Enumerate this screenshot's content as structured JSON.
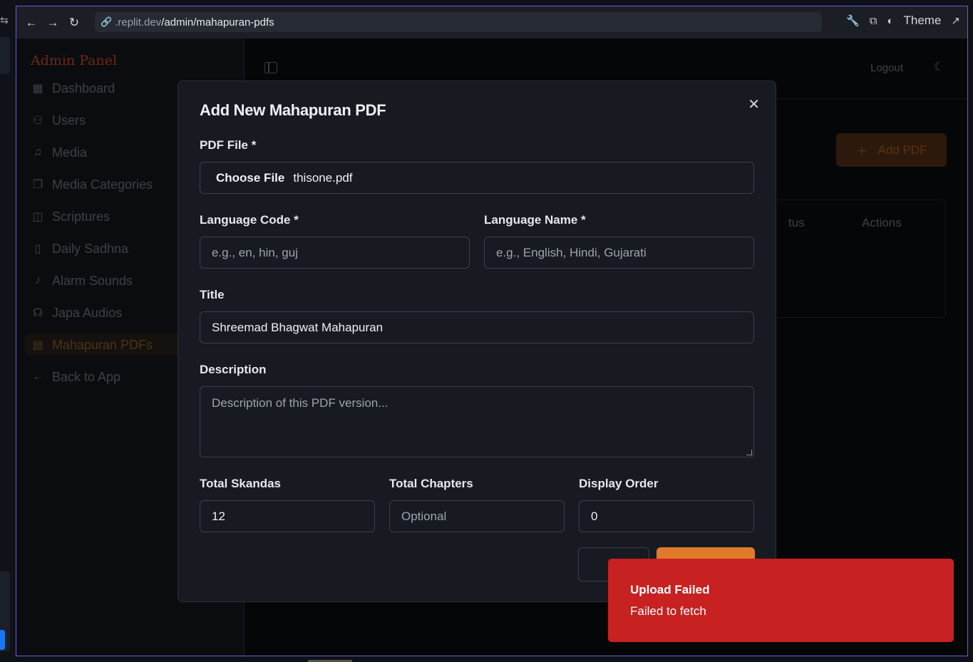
{
  "browser": {
    "url_host": ".replit.dev",
    "url_path": "/admin/mahapuran-pdfs",
    "theme_label": "Theme"
  },
  "sidebar": {
    "brand": "Admin Panel",
    "items": [
      {
        "label": "Dashboard",
        "icon": "grid-icon"
      },
      {
        "label": "Users",
        "icon": "users-icon"
      },
      {
        "label": "Media",
        "icon": "music-icon"
      },
      {
        "label": "Media Categories",
        "icon": "folders-icon"
      },
      {
        "label": "Scriptures",
        "icon": "book-open-icon"
      },
      {
        "label": "Daily Sadhna",
        "icon": "book-icon"
      },
      {
        "label": "Alarm Sounds",
        "icon": "bell-icon"
      },
      {
        "label": "Japa Audios",
        "icon": "headphones-icon"
      },
      {
        "label": "Mahapuran PDFs",
        "icon": "file-text-icon"
      },
      {
        "label": "Back to App",
        "icon": "arrow-left-icon"
      }
    ]
  },
  "header": {
    "logout": "Logout"
  },
  "main": {
    "add_pdf": "Add PDF",
    "table_headers": [
      "tus",
      "Actions"
    ]
  },
  "modal": {
    "title": "Add New Mahapuran PDF",
    "pdf_file_label": "PDF File *",
    "choose_file": "Choose File",
    "file_name": "thisone.pdf",
    "language_code_label": "Language Code *",
    "language_code_placeholder": "e.g., en, hin, guj",
    "language_name_label": "Language Name *",
    "language_name_placeholder": "e.g., English, Hindi, Gujarati",
    "title_label": "Title",
    "title_value": "Shreemad Bhagwat Mahapuran",
    "description_label": "Description",
    "description_placeholder": "Description of this PDF version...",
    "total_skandas_label": "Total Skandas",
    "total_skandas_value": "12",
    "total_chapters_label": "Total Chapters",
    "total_chapters_placeholder": "Optional",
    "display_order_label": "Display Order",
    "display_order_value": "0"
  },
  "toast": {
    "title": "Upload Failed",
    "description": "Failed to fetch"
  }
}
